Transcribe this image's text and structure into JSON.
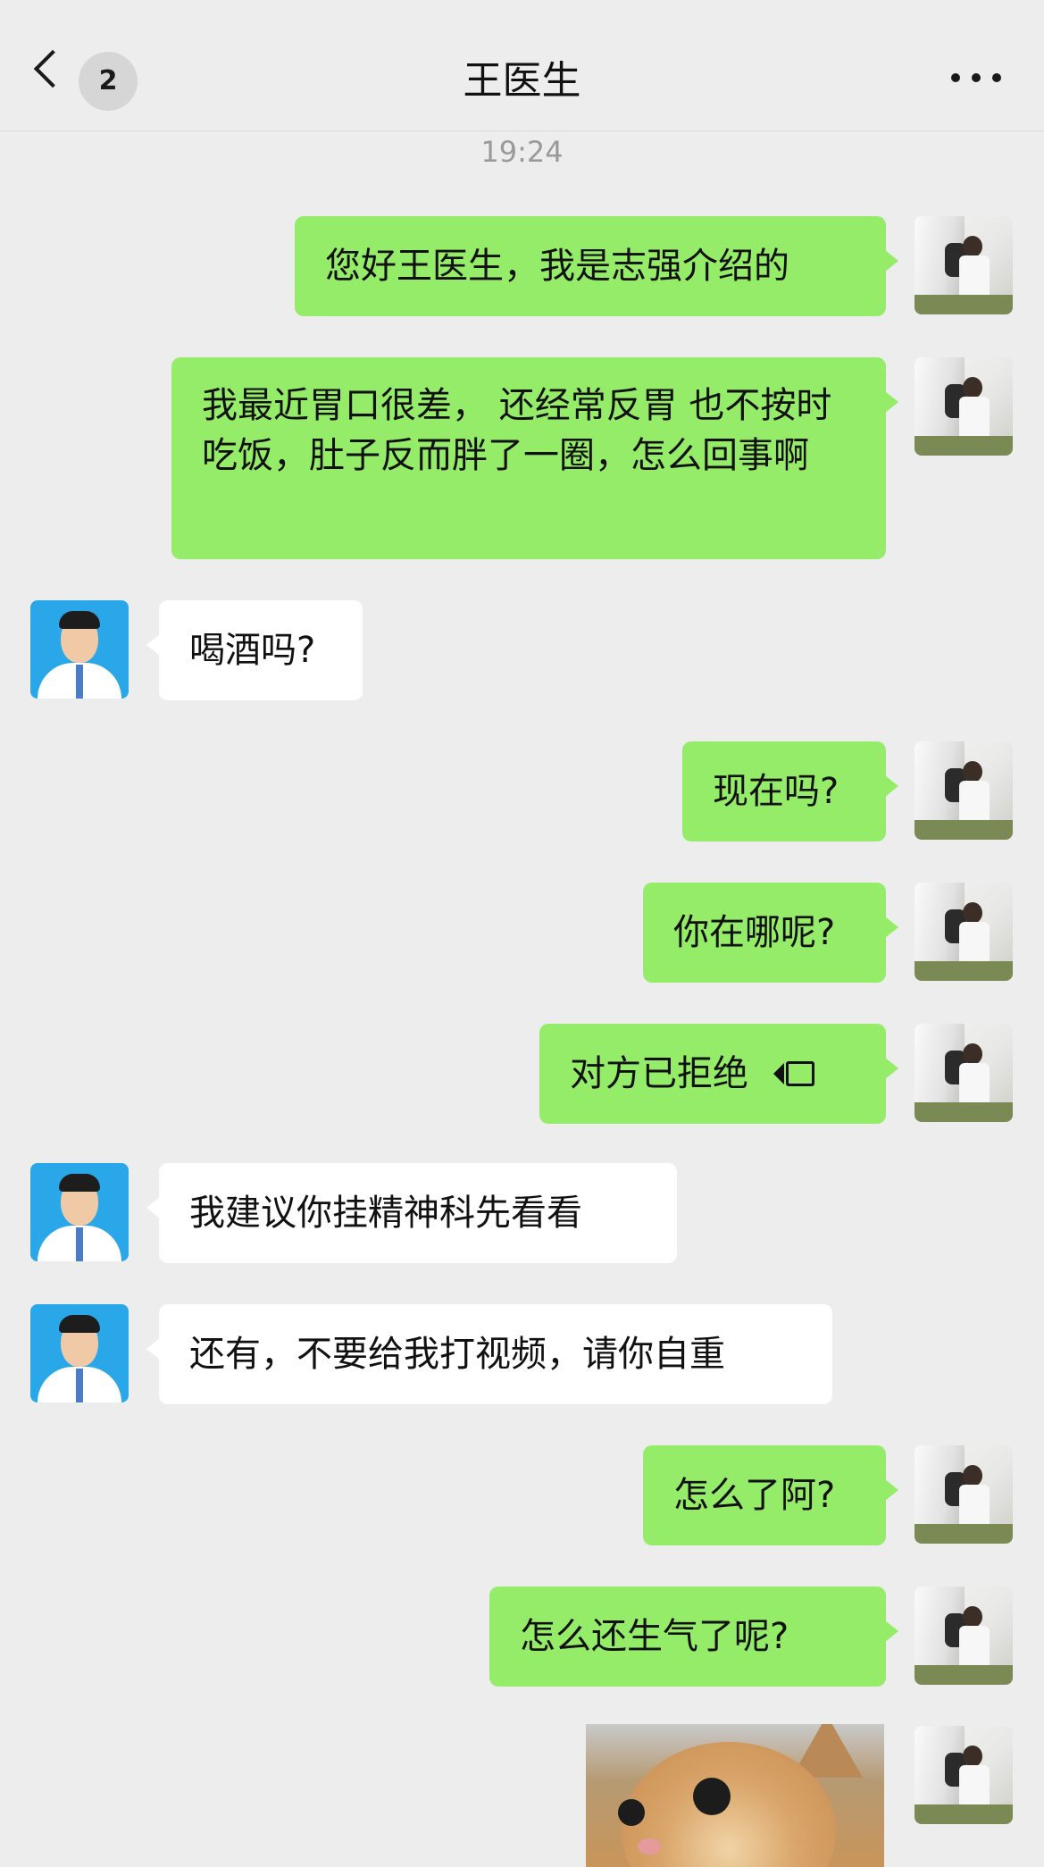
{
  "header": {
    "back_badge": "2",
    "title": "王医生"
  },
  "timestamp": "19:24",
  "messages": [
    {
      "from": "me",
      "text": "您好王医生，我是志强介绍的"
    },
    {
      "from": "me",
      "text": "我最近胃口很差， 还经常反胃  也不按时吃饭，肚子反而胖了一圈，怎么回事啊"
    },
    {
      "from": "doctor",
      "text": "喝酒吗?"
    },
    {
      "from": "me",
      "text": "现在吗?"
    },
    {
      "from": "me",
      "text": "你在哪呢?"
    },
    {
      "from": "me",
      "text": "对方已拒绝",
      "icon": "video-call-icon"
    },
    {
      "from": "doctor",
      "text": "我建议你挂精神科先看看"
    },
    {
      "from": "doctor",
      "text": "还有，不要给我打视频，请你自重"
    },
    {
      "from": "me",
      "text": "怎么了阿?"
    },
    {
      "from": "me",
      "text": "怎么还生气了呢?"
    },
    {
      "from": "me",
      "type": "image",
      "image": "cat-photo"
    }
  ],
  "colors": {
    "background": "#ededed",
    "my_bubble": "#95ec69",
    "their_bubble": "#ffffff"
  }
}
